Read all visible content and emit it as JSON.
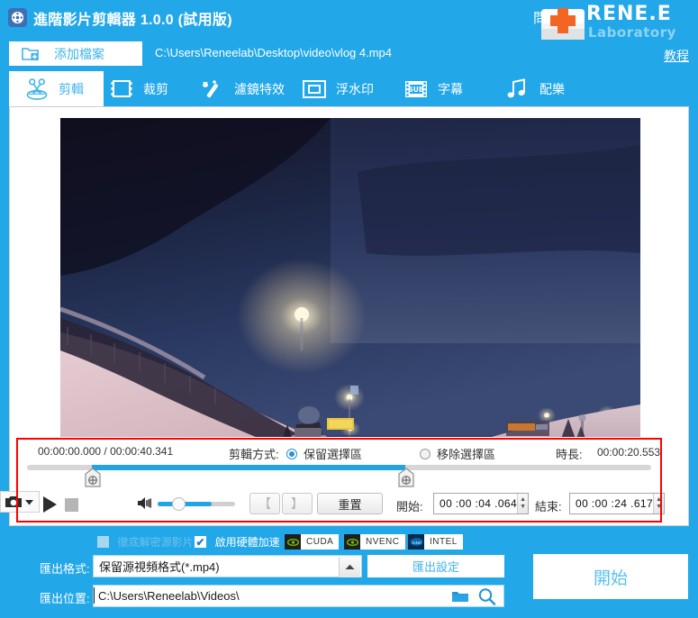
{
  "window": {
    "title": "進階影片剪輯器 1.0.0 (試用版)",
    "logo_icon": "film-reel-icon",
    "help_glyph": "問",
    "brand_name": "RENE.E",
    "brand_sub": "Laboratory",
    "brand_icon": "first-aid-kit-icon",
    "tutorial_label": "教程",
    "accent": "#22a7e8",
    "panel_bg": "#ffffff",
    "highlight": "#ff0000"
  },
  "toolbar": {
    "add_file_label": "添加檔案",
    "add_file_icon": "add-file-icon",
    "file_path": "C:\\Users\\Reneelab\\Desktop\\video\\vlog 4.mp4"
  },
  "tabs": [
    {
      "label": "剪輯",
      "icon": "scissors-icon",
      "active": true
    },
    {
      "label": "裁剪",
      "icon": "crop-film-icon",
      "active": false
    },
    {
      "label": "濾鏡特效",
      "icon": "magic-wand-icon",
      "active": false
    },
    {
      "label": "浮水印",
      "icon": "watermark-frame-icon",
      "active": false
    },
    {
      "label": "字幕",
      "icon": "subtitle-sub-icon",
      "active": false
    },
    {
      "label": "配樂",
      "icon": "music-note-icon",
      "active": false
    }
  ],
  "preview": {
    "scene": "night-driving-snowy-road"
  },
  "timeline": {
    "current_time": "00:00:00.000",
    "separator": "/",
    "total_time": "00:00:40.341",
    "time_display": "00:00:00.000 / 00:00:40.341",
    "trim_mode_label": "剪輯方式:",
    "trim_options": [
      {
        "label": "保留選擇區",
        "selected": true
      },
      {
        "label": "移除選擇區",
        "selected": false
      }
    ],
    "duration_label": "時長:",
    "duration_value": "00:00:20.553",
    "selection_start_pct": 10.4,
    "selection_end_pct": 60.6
  },
  "controls": {
    "play_icon": "play-icon",
    "stop_icon": "stop-icon",
    "snapshot_icon": "camera-icon",
    "snapshot_dropdown_icon": "chevron-down-icon",
    "volume_icon": "speaker-icon",
    "volume_pct": 70,
    "mark_in_label": "【",
    "mark_out_label": "】",
    "reset_label": "重置",
    "start_label": "開始:",
    "start_value": "00 :00 :04 .064",
    "end_label": "結束:",
    "end_value": "00 :00 :24 .617",
    "spinner_up_icon": "caret-up-icon",
    "spinner_down_icon": "caret-down-icon"
  },
  "options": {
    "decrypt_label": "徹底解密源影片",
    "decrypt_checked": false,
    "decrypt_disabled": true,
    "hwaccel_label": "啟用硬體加速",
    "hwaccel_checked": true,
    "accelerators": [
      {
        "label": "CUDA",
        "icon": "nvidia-eye-icon"
      },
      {
        "label": "NVENC",
        "icon": "nvidia-eye-icon"
      },
      {
        "label": "INTEL",
        "icon": "intel-logo-icon"
      }
    ]
  },
  "export": {
    "format_label": "匯出格式:",
    "format_value": "保留源視頻格式(*.mp4)",
    "format_arrow_icon": "caret-up-icon",
    "settings_label": "匯出設定",
    "location_label": "匯出位置:",
    "location_value": "C:\\Users\\Reneelab\\Videos\\",
    "folder_icon": "folder-icon",
    "search_icon": "search-icon",
    "start_label": "開始"
  }
}
